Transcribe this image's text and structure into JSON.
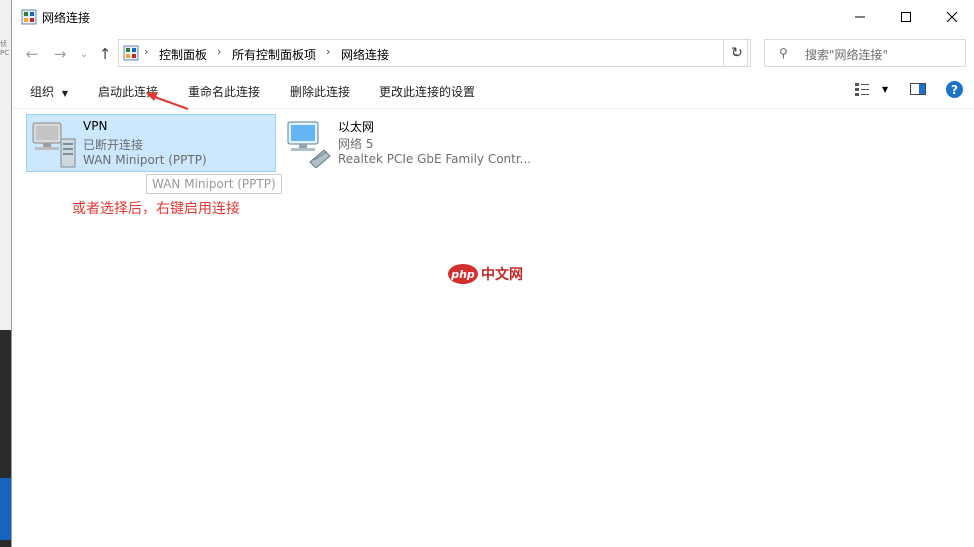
{
  "window": {
    "title": "网络连接"
  },
  "address_bar": {
    "breadcrumbs": [
      "控制面板",
      "所有控制面板项",
      "网络连接"
    ]
  },
  "search": {
    "placeholder": "搜索\"网络连接\""
  },
  "command_bar": {
    "organize": "组织",
    "start_connection": "启动此连接",
    "rename": "重命名此连接",
    "delete": "删除此连接",
    "change_settings": "更改此连接的设置"
  },
  "connections": [
    {
      "name": "VPN",
      "status": "已断开连接",
      "device": "WAN Miniport (PPTP)",
      "selected": true
    },
    {
      "name": "以太网",
      "status": "网络 5",
      "device": "Realtek PCIe GbE Family Contr..."
    }
  ],
  "tooltip": "WAN Miniport (PPTP)",
  "annotation": {
    "text": "或者选择后，右键启用连接",
    "color": "#e53935"
  },
  "watermark": {
    "badge": "php",
    "text": "中文网"
  },
  "colors": {
    "selection": "#cce8ff",
    "help": "#1a73c8"
  }
}
